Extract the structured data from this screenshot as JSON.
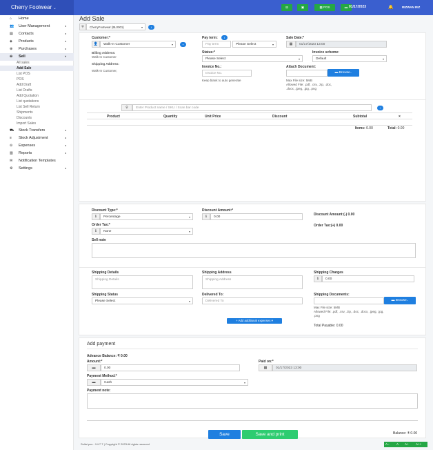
{
  "topbar": {
    "brand": "Cherry Foolwear",
    "pos_label": "POS",
    "date": "01/17/2023",
    "user": "RIZWAN RIZ"
  },
  "sidebar": {
    "items": [
      {
        "label": "Home",
        "icon": "home-icon"
      },
      {
        "label": "User Management",
        "icon": "users-icon"
      },
      {
        "label": "Contacts",
        "icon": "address-book-icon"
      },
      {
        "label": "Products",
        "icon": "cubes-icon"
      },
      {
        "label": "Purchases",
        "icon": "purchase-icon"
      },
      {
        "label": "Sell",
        "icon": "sell-icon"
      }
    ],
    "sell_sub": [
      "All sales",
      "Add Sale",
      "List POS",
      "POS",
      "Add Draft",
      "List Drafts",
      "Add Quotation",
      "List quotations",
      "List Sell Return",
      "Shipments",
      "Discounts",
      "Import Sales"
    ],
    "items2": [
      {
        "label": "Stock Transfers",
        "icon": "truck-icon"
      },
      {
        "label": "Stock Adjustment",
        "icon": "database-icon"
      },
      {
        "label": "Expenses",
        "icon": "minus-circle-icon"
      },
      {
        "label": "Reports",
        "icon": "chart-icon"
      },
      {
        "label": "Notification Templates",
        "icon": "envelope-icon"
      },
      {
        "label": "Settings",
        "icon": "gear-icon"
      }
    ]
  },
  "page": {
    "title": "Add Sale",
    "location": "CherryFootwear (BL0001)"
  },
  "form": {
    "customer_label": "Customer:*",
    "customer_value": "Walk-In Customer",
    "billing_label": "Billing Address:",
    "billing_value": "Walk-In Customer",
    "shipping_label": "Shipping Address:",
    "shipping_value": "Walk-In Customer,",
    "pay_term_label": "Pay term:",
    "pay_term_placeholder": "Pay term",
    "pay_term_select": "Please Select",
    "sale_date_label": "Sale Date:*",
    "sale_date_value": "01/17/2023 13:00",
    "status_label": "Status:*",
    "status_value": "Please Select",
    "invoice_scheme_label": "Invoice scheme:",
    "invoice_scheme_value": "Default",
    "invoice_no_label": "Invoice No.:",
    "invoice_no_placeholder": "Invoice No.",
    "invoice_help": "Keep blank to auto generate",
    "attach_label": "Attach Document:",
    "browse": "Browse..",
    "attach_help_1": "Max File size: 5MB",
    "attach_help_2": "Allowed File: .pdf, .csv, .zip, .doc,",
    "attach_help_3": ".docx, .jpeg, .jpg, .png"
  },
  "products": {
    "search_placeholder": "Enter Product name / SKU / Scan bar code",
    "columns": [
      "Product",
      "Quantity",
      "Unit Price",
      "Discount",
      "Subtotal",
      "×"
    ],
    "items_label": "Items:",
    "items_value": "0.00",
    "total_label": "Total:",
    "total_value": "0.00"
  },
  "discount": {
    "type_label": "Discount Type:*",
    "type_value": "Percentage",
    "amount_label": "Discount Amount:*",
    "amount_value": "0.00",
    "amount_summary": "Discount Amount:(-) 0.00",
    "tax_label": "Order Tax:*",
    "tax_value": "None",
    "tax_summary": "Order Tax:(+) 0.00",
    "sell_note_label": "Sell note"
  },
  "shipping": {
    "details_label": "Shipping Details",
    "details_placeholder": "Shipping Details",
    "address_label": "Shipping Address",
    "address_placeholder": "Shipping Address",
    "charges_label": "Shipping Charges",
    "charges_value": "0.00",
    "status_label": "Shipping Status",
    "status_value": "Please Select",
    "delivered_label": "Delivered To:",
    "delivered_placeholder": "Delivered To",
    "docs_label": "Shipping Documents:",
    "browse": "Browse..",
    "docs_help_1": "Max File size: 5MB",
    "docs_help_2": "Allowed File: .pdf, .csv, .zip, .doc, .docx, .jpeg, .jpg,",
    "docs_help_3": ".png",
    "add_expenses": "+ Add additional expenses",
    "total_payable": "Total Payable: 0.00"
  },
  "payment": {
    "title": "Add payment",
    "advance_balance": "Advance Balance: ₹ 0.00",
    "amount_label": "Amount:*",
    "amount_value": "0.00",
    "paid_on_label": "Paid on:*",
    "paid_on_value": "01/17/2023 13:00",
    "method_label": "Payment Method:*",
    "method_value": "Cash",
    "note_label": "Payment note:",
    "balance": "Balance: ₹ 0.00"
  },
  "actions": {
    "save": "Save",
    "save_print": "Save and print"
  },
  "footer": {
    "copyright": "Sollai pos - V4.7.7 | Copyright © 2023 All rights reserved",
    "font_buttons": [
      "A−",
      "A",
      "A+",
      "A++"
    ]
  },
  "colors": {
    "primary": "#3a5fcf",
    "success": "#25a745",
    "link": "#1f7fe0"
  }
}
